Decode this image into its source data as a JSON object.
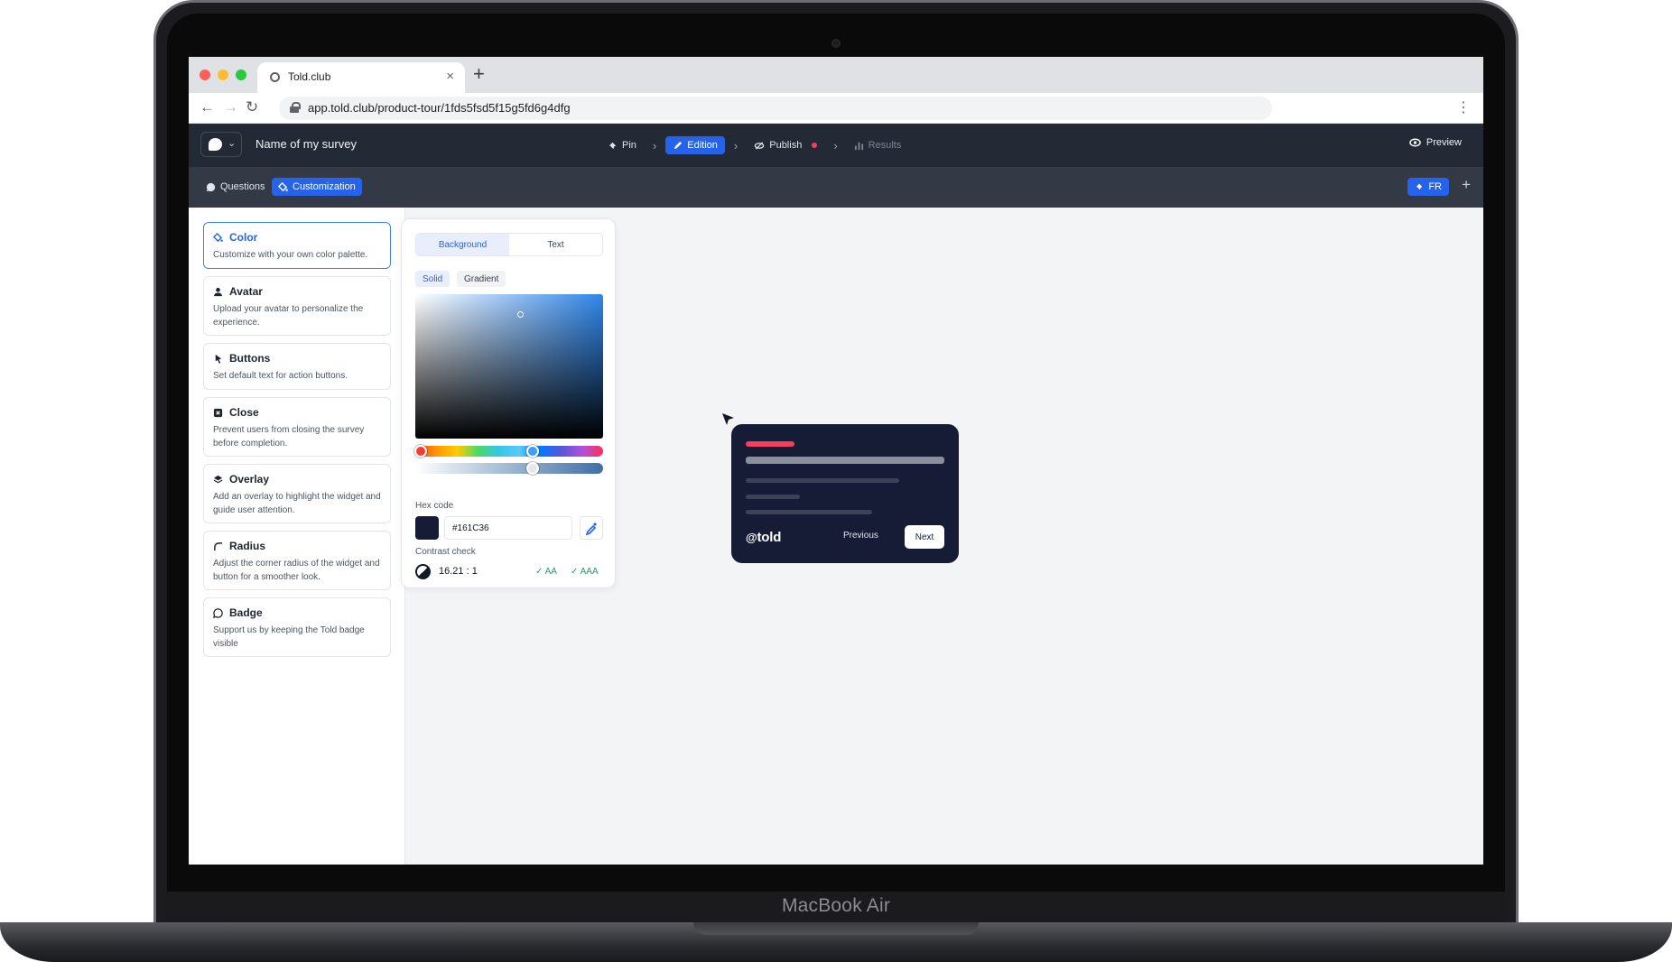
{
  "device": {
    "label": "MacBook Air"
  },
  "browser": {
    "tab_title": "Told.club",
    "tab_close": "×",
    "new_tab": "+",
    "url": "app.told.club/product-tour/1fds5fsd5f15g5fd6g4dfg",
    "back": "←",
    "forward": "→",
    "reload": "↻",
    "menu": "⋮",
    "traffic_lights": [
      "#ff5f57",
      "#febc2e",
      "#28c840"
    ]
  },
  "appbar": {
    "survey_name": "Name of my survey",
    "steps": [
      {
        "label": "Pin",
        "icon": "pin-icon",
        "state": "normal"
      },
      {
        "label": "Edition",
        "icon": "pencil-icon",
        "state": "active"
      },
      {
        "label": "Publish",
        "icon": "eye-off-icon",
        "state": "normal"
      },
      {
        "label": "Results",
        "icon": "bar-chart-icon",
        "state": "disabled"
      }
    ],
    "preview": "Preview"
  },
  "subbar": {
    "tabs": [
      {
        "label": "Questions",
        "icon": "chat-icon",
        "active": false
      },
      {
        "label": "Customization",
        "icon": "paint-bucket-icon",
        "active": true
      }
    ],
    "language": "FR",
    "add": "+"
  },
  "sections": [
    {
      "title": "Color",
      "icon": "paint-bucket-icon",
      "desc": "Customize with your own color palette.",
      "active": true
    },
    {
      "title": "Avatar",
      "icon": "user-icon",
      "desc": "Upload your avatar to personalize the experience.",
      "active": false
    },
    {
      "title": "Buttons",
      "icon": "pointer-icon",
      "desc": "Set default text for action buttons.",
      "active": false
    },
    {
      "title": "Close",
      "icon": "close-square-icon",
      "desc": "Prevent users from closing the survey before completion.",
      "active": false
    },
    {
      "title": "Overlay",
      "icon": "layers-icon",
      "desc": "Add an overlay to highlight the widget and guide user attention.",
      "active": false
    },
    {
      "title": "Radius",
      "icon": "corner-icon",
      "desc": "Adjust the corner radius of the widget and button for a smoother look.",
      "active": false
    },
    {
      "title": "Badge",
      "icon": "badge-bubble-icon",
      "desc": "Support us by keeping the Told badge visible",
      "active": false
    }
  ],
  "picker": {
    "segments": [
      "Background",
      "Text"
    ],
    "active_segment": "Background",
    "modes": [
      "Solid",
      "Gradient"
    ],
    "active_mode": "Solid",
    "hex_label": "Hex code",
    "hex_value": "#161C36",
    "contrast_label": "Contrast check",
    "contrast_ratio": "16.21 : 1",
    "checks": [
      "AA",
      "AAA"
    ],
    "check_mark": "✓"
  },
  "widget": {
    "brand": "told",
    "previous": "Previous",
    "next": "Next",
    "accent": "#f43f5e"
  },
  "colors": {
    "app_dark": "#242a35",
    "sub_dark": "#333a46",
    "primary": "#2563eb",
    "widget_bg": "#161c36"
  }
}
